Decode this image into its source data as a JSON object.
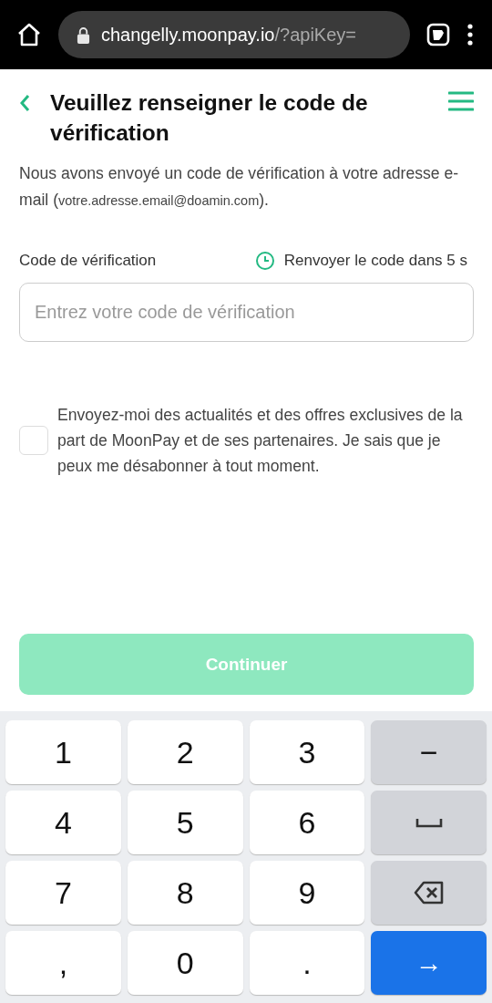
{
  "browser": {
    "url_host": "changelly.moonpay.io",
    "url_path": "/?apiKey="
  },
  "page": {
    "title": "Veuillez renseigner le code de vérification",
    "intro": {
      "before": "Nous avons envoyé un code de vérification à votre adresse e-mail (",
      "email": "votre.adresse.email@doamin.com",
      "after": ")."
    },
    "code_label": "Code de vérification",
    "resend": "Renvoyer le code dans 5 s",
    "code_field": {
      "placeholder": "Entrez votre code de vérification"
    },
    "consent": {
      "checked": false,
      "text": "Envoyez-moi des actualités et des offres exclusives de la part de MoonPay et de ses partenaires. Je sais que je peux me désabonner à tout moment."
    },
    "continue": {
      "label": "Continuer",
      "disabled": true
    }
  },
  "keyboard": [
    {
      "kind": "char",
      "label": "1"
    },
    {
      "kind": "char",
      "label": "2"
    },
    {
      "kind": "char",
      "label": "3"
    },
    {
      "kind": "symbol",
      "label": "−"
    },
    {
      "kind": "char",
      "label": "4"
    },
    {
      "kind": "char",
      "label": "5"
    },
    {
      "kind": "char",
      "label": "6"
    },
    {
      "kind": "space"
    },
    {
      "kind": "char",
      "label": "7"
    },
    {
      "kind": "char",
      "label": "8"
    },
    {
      "kind": "char",
      "label": "9"
    },
    {
      "kind": "backspace"
    },
    {
      "kind": "char",
      "label": ","
    },
    {
      "kind": "char",
      "label": "0"
    },
    {
      "kind": "char",
      "label": "."
    },
    {
      "kind": "enter",
      "label": "→"
    }
  ]
}
